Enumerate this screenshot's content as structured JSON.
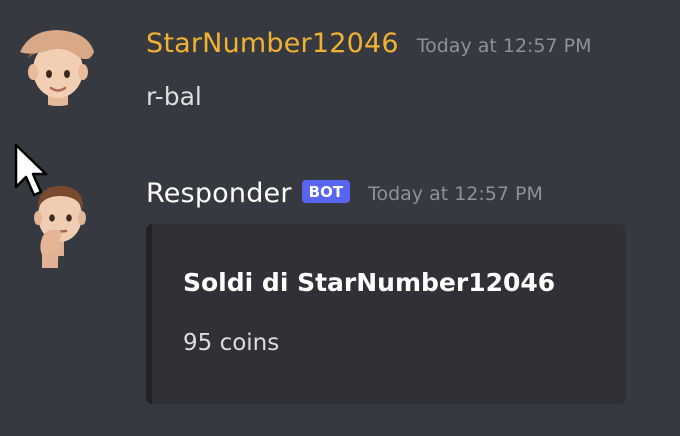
{
  "messages": [
    {
      "username": "StarNumber12046",
      "timestamp": "Today at 12:57 PM",
      "content": "r-bal",
      "avatar_icon": "memoji-avatar-icon",
      "name_color": "#f0b232"
    },
    {
      "username": "Responder",
      "badge": "BOT",
      "timestamp": "Today at 12:57 PM",
      "avatar_icon": "thinking-memoji-avatar-icon",
      "embed": {
        "title": "Soldi di StarNumber12046",
        "description": "95 coins"
      }
    }
  ],
  "colors": {
    "background": "#36393f",
    "embed_background": "#2f3136",
    "bot_badge": "#5865f2",
    "timestamp": "#8e9297"
  }
}
